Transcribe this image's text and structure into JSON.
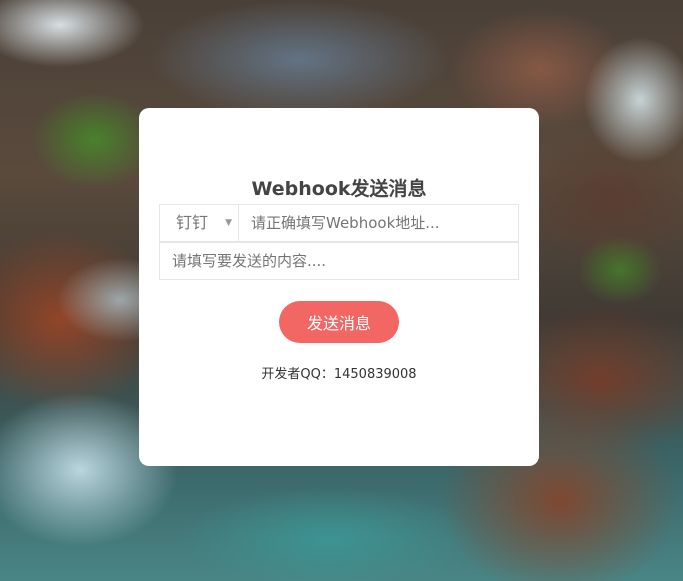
{
  "form": {
    "title": "Webhook发送消息",
    "platform_select": {
      "selected": "钉钉"
    },
    "webhook_input": {
      "value": "",
      "placeholder": "请正确填写Webhook地址..."
    },
    "content_input": {
      "value": "",
      "placeholder": "请填写要发送的内容...."
    },
    "send_label": "发送消息",
    "developer_text": "开发者QQ：1450839008"
  },
  "colors": {
    "accent": "#f26664",
    "card": "#ffffff",
    "title": "#444444"
  }
}
